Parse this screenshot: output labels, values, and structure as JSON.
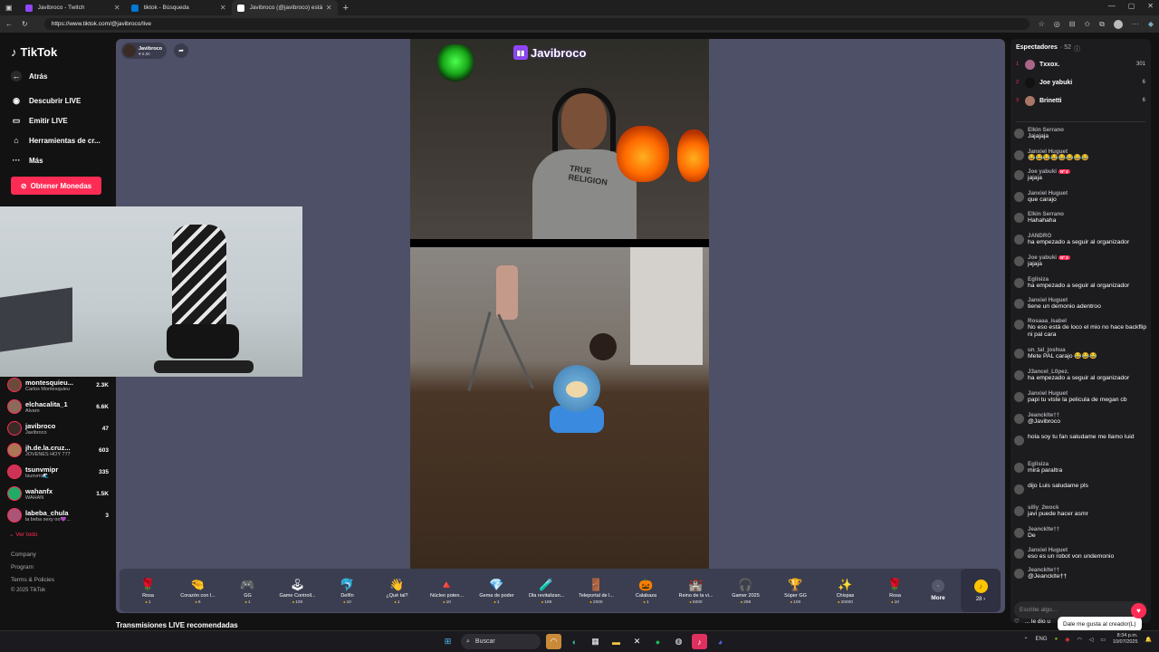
{
  "browser": {
    "tabs": [
      {
        "title": "Javibroco - Twitch",
        "color": "#9146ff",
        "active": false
      },
      {
        "title": "tiktok - Búsqueda",
        "color": "#0078d4",
        "active": false
      },
      {
        "title": "Javibroco (@javibroco) está",
        "color": "#ffffff",
        "active": true
      }
    ],
    "new_tab": "+",
    "url": "https://www.tiktok.com/@javibroco/live"
  },
  "sidebar": {
    "logo": "TikTok",
    "back": "Atrás",
    "discover": "Descubrir LIVE",
    "emit": "Emitir LIVE",
    "tools": "Herramientas de cr...",
    "more": "Más",
    "coins_button": "Obtener Monedas",
    "accounts": [
      {
        "name": "montesquieu...",
        "sub": "Carlos Montesquieu",
        "viewers": "2.3K",
        "color": "#6b4a3a"
      },
      {
        "name": "elchacalita_1",
        "sub": "Alvaro",
        "viewers": "6.6K",
        "color": "#8a6a5a"
      },
      {
        "name": "javibroco",
        "sub": "Javibroco",
        "viewers": "47",
        "color": "#3b2b25"
      },
      {
        "name": "jh.de.la.cruz...",
        "sub": "JÓVENES HOY 777",
        "viewers": "603",
        "color": "#aa7755"
      },
      {
        "name": "tsunvmipr",
        "sub": "tsunvmi🌊",
        "viewers": "335",
        "color": "#cc3355"
      },
      {
        "name": "wahanfx",
        "sub": "WAHAN",
        "viewers": "1.5K",
        "color": "#22aa66"
      },
      {
        "name": "labeba_chula",
        "sub": "la beba sexy oo💜...",
        "viewers": "3",
        "color": "#aa5577"
      }
    ],
    "see_all": "Ver todo",
    "footer": [
      "Company",
      "Program",
      "Terms & Policies",
      "© 2025 TikTok"
    ]
  },
  "player": {
    "host_name": "Javibroco",
    "host_likes": "♥ 6.5K",
    "twitch_overlay_name": "Javibroco",
    "person_shirt_text": "TRUE RELIGION"
  },
  "gifts": [
    {
      "name": "Rosa",
      "price": "1",
      "icon": "🌹"
    },
    {
      "name": "Corazón con l...",
      "price": "5",
      "icon": "🤏"
    },
    {
      "name": "GG",
      "price": "1",
      "icon": "🎮"
    },
    {
      "name": "Game Controll...",
      "price": "100",
      "icon": "🕹"
    },
    {
      "name": "Delfín",
      "price": "10",
      "icon": "🐬"
    },
    {
      "name": "¿Qué tal?",
      "price": "1",
      "icon": "👋"
    },
    {
      "name": "Núcleo poten...",
      "price": "10",
      "icon": "🔺"
    },
    {
      "name": "Gema de poder",
      "price": "1",
      "icon": "💎"
    },
    {
      "name": "Ola revitalizan...",
      "price": "199",
      "icon": "🧪"
    },
    {
      "name": "Teleportal de l...",
      "price": "2000",
      "icon": "🚪"
    },
    {
      "name": "Calabaza",
      "price": "1",
      "icon": "🎃"
    },
    {
      "name": "Reino de la vi...",
      "price": "5000",
      "icon": "🏰"
    },
    {
      "name": "Gamer 2025",
      "price": "299",
      "icon": "🎧"
    },
    {
      "name": "Súper GG",
      "price": "100",
      "icon": "🏆"
    },
    {
      "name": "Chispas",
      "price": "20000",
      "icon": "✨"
    },
    {
      "name": "Rosa",
      "price": "10",
      "icon": "🌹"
    }
  ],
  "gifts_more": "More",
  "coins_count": "28",
  "recommended_title": "Transmisiones LIVE recomendadas",
  "chat": {
    "viewers_label": "Espectadores",
    "viewers_count": "· 52",
    "top": [
      {
        "rank": "1",
        "name": "Txxox.",
        "score": "301",
        "color": "#aa6688"
      },
      {
        "rank": "2",
        "name": "Joe yabuki",
        "score": "6",
        "color": "#111111"
      },
      {
        "rank": "3",
        "name": "Brinetti",
        "score": "6",
        "color": "#aa7766"
      }
    ],
    "messages": [
      {
        "user": "Elkin Serrano",
        "text": "Jajajaja",
        "badge": ""
      },
      {
        "user": "Janxiel Huguet",
        "text": "😂😂😂😂😂😂😂😂",
        "badge": ""
      },
      {
        "user": "Joe yabuki",
        "text": "jajaja",
        "badge": "Nº 2"
      },
      {
        "user": "Janxiel Huguet",
        "text": "que carajo",
        "badge": ""
      },
      {
        "user": "Elkin Serrano",
        "text": "Hahahaha",
        "badge": ""
      },
      {
        "user": "JANDRO",
        "text": "ha empezado a seguir al organizador",
        "badge": ""
      },
      {
        "user": "Joe yabuki",
        "text": "jajaja",
        "badge": "Nº 2"
      },
      {
        "user": "Eglisiza",
        "text": "ha empezado a seguir al organizador",
        "badge": ""
      },
      {
        "user": "Janxiel Huguet",
        "text": "tiene un demonio adentroo",
        "badge": ""
      },
      {
        "user": "Rosaaa_isabel",
        "text": "No eso está de loco el mio no hace backflip ni pal cara",
        "badge": ""
      },
      {
        "user": "un_tal_joshua",
        "text": "Mete PAL carajo 😂😂😂",
        "badge": ""
      },
      {
        "user": "J3ancel_L0pez.",
        "text": "ha empezado a seguir al organizador",
        "badge": ""
      },
      {
        "user": "Janxiel Huguet",
        "text": "papi tu viste la pelicula de megan cb",
        "badge": ""
      },
      {
        "user": "Jeancklte††",
        "text": "@Javibroco",
        "badge": ""
      },
      {
        "user": "",
        "text": "hola soy tu fan saludame me llamo luid",
        "badge": ""
      },
      {
        "user": "Eglisiza",
        "text": "mirá paraltra",
        "badge": ""
      },
      {
        "user": "",
        "text": "dijo Luis saludame pls",
        "badge": ""
      },
      {
        "user": "silly_2wock",
        "text": "javi puede hacer asmr",
        "badge": ""
      },
      {
        "user": "Jeancklte††",
        "text": "De",
        "badge": ""
      },
      {
        "user": "Janxiel Huguet",
        "text": "eso es un robot von undemonio",
        "badge": ""
      },
      {
        "user": "Jeancklte††",
        "text": "@Jeancklte††",
        "badge": ""
      }
    ],
    "like_row": "... le dio u",
    "input_placeholder": "Escribe algo...",
    "tooltip": "Dale me gusta al creador(L)"
  },
  "taskbar": {
    "search": "Buscar",
    "lang": "ENG",
    "time": "8:34 p.m.",
    "date": "10/07/2025"
  }
}
